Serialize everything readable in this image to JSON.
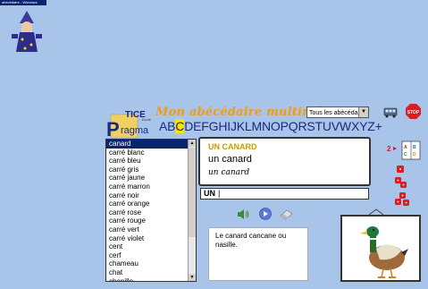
{
  "window": {
    "title": "abécédaire - Windows"
  },
  "header": {
    "logo_text_top": "TICE",
    "logo_text_sub": "Ecole",
    "logo_text_main": "ragma",
    "app_title": "Mon abécédaire multimédia",
    "dict_select": {
      "value": "Tous les abécédaires"
    }
  },
  "alphabet": {
    "letters": [
      "A",
      "B",
      "C",
      "D",
      "E",
      "F",
      "G",
      "H",
      "I",
      "J",
      "K",
      "L",
      "M",
      "N",
      "O",
      "P",
      "Q",
      "R",
      "S",
      "T",
      "U",
      "V",
      "W",
      "X",
      "Y",
      "Z",
      "+"
    ],
    "selected": "C"
  },
  "word_list": {
    "items": [
      "canard",
      "carré blanc",
      "carré bleu",
      "carré gris",
      "carré jaune",
      "carré marron",
      "carré noir",
      "carré orange",
      "carré rose",
      "carré rouge",
      "carré vert",
      "carré violet",
      "cent",
      "cerf",
      "chameau",
      "chat",
      "chenille"
    ],
    "selected_index": 0
  },
  "word_card": {
    "upper": "UN CANARD",
    "lower": "un canard",
    "cursive": "un canard"
  },
  "answer_input": {
    "value": "UN"
  },
  "note": {
    "text": "Le canard cancane ou nasille."
  },
  "icons": {
    "stop": "stop-icon",
    "bus": "bus-icon",
    "speaker": "speaker-icon",
    "play": "play-icon",
    "eraser": "eraser-icon",
    "alpha_link": "alphabet-book-icon",
    "dice": "dice-icon",
    "wizard": "wizard-icon"
  },
  "colors": {
    "background": "#a8c4e8",
    "title": "#f29a1a",
    "alphabet": "#1b2a80",
    "selected_letter_bg": "#f5e400",
    "selection": "#0a2470"
  }
}
